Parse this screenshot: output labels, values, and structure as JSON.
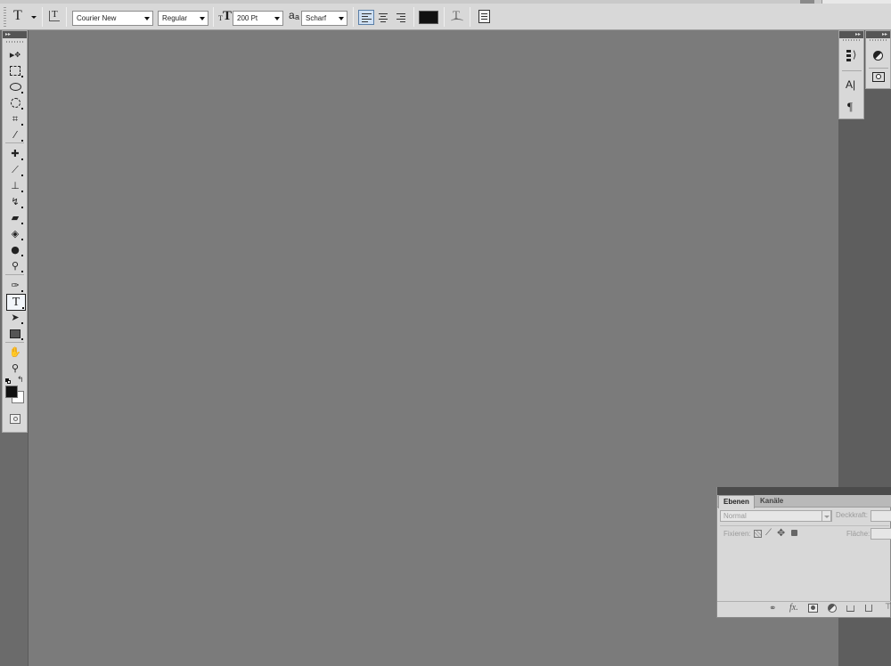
{
  "options_bar": {
    "tool_icon": "T",
    "orient_icon": "text-orientation-icon",
    "font_family": "Courier New",
    "font_style": "Regular",
    "font_size": "200 Pt",
    "antialias_label": "a",
    "antialias_sub": "a",
    "antialias": "Scharf",
    "text_color": "#111111"
  },
  "tools": {
    "type_glyph": "T",
    "foreground_color": "#111111",
    "background_color": "#ffffff"
  },
  "right_dock": {
    "character_glyph": "A|",
    "paragraph_glyph": "¶"
  },
  "layers_panel": {
    "tabs": [
      "Ebenen",
      "Kanäle"
    ],
    "blend_mode": "Normal",
    "opacity_label": "Deckkraft:",
    "lock_label": "Fixieren:",
    "fill_label": "Fläche:",
    "fx_label": "fx."
  },
  "colors": {
    "canvas": "#7b7b7b",
    "panel": "#d8d8d8",
    "dock_bg": "#5e5e5e"
  }
}
